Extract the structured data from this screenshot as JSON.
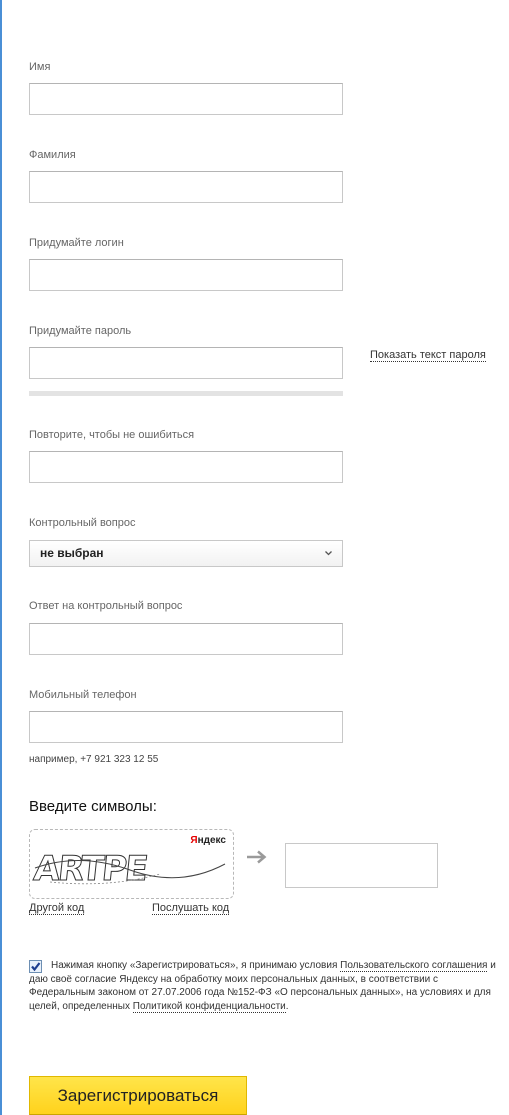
{
  "form": {
    "first_name": {
      "label": "Имя",
      "value": ""
    },
    "last_name": {
      "label": "Фамилия",
      "value": ""
    },
    "login": {
      "label": "Придумайте логин",
      "value": ""
    },
    "password": {
      "label": "Придумайте пароль",
      "value": "",
      "show_link": "Показать текст пароля"
    },
    "password_repeat": {
      "label": "Повторите, чтобы не ошибиться",
      "value": ""
    },
    "security_question": {
      "label": "Контрольный вопрос",
      "selected": "не выбран"
    },
    "security_answer": {
      "label": "Ответ на контрольный вопрос",
      "value": ""
    },
    "phone": {
      "label": "Мобильный телефон",
      "value": "",
      "hint": "например, +7 921 323 12 55"
    }
  },
  "captcha": {
    "title": "Введите символы:",
    "logo_first": "Я",
    "logo_rest": "ндекс",
    "image_text": "ARTPE",
    "other_code_link": "Другой код",
    "listen_link": "Послушать код",
    "value": ""
  },
  "terms": {
    "checked": true,
    "text_1": "Нажимая кнопку «Зарегистрироваться», я принимаю условия ",
    "agreement_link": "Пользовательского соглашения",
    "text_2": " и даю своё согласие Яндексу на обработку моих персональных данных, в соответствии с Федеральным законом от 27.07.2006 года №152-ФЗ «О персональных данных», на условиях и для целей, определенных ",
    "privacy_link": "Политикой конфиденциальности",
    "text_3": "."
  },
  "submit_label": "Зарегистрироваться",
  "colors": {
    "accent_border": "#4a8fd6",
    "button_yellow": "#ffd21c"
  }
}
